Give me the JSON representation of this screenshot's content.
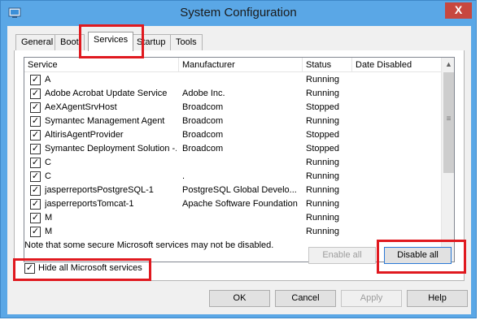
{
  "window": {
    "title": "System Configuration",
    "close_glyph": "X",
    "icon": "system-config-icon"
  },
  "tabs": [
    {
      "label": "General",
      "active": false
    },
    {
      "label": "Boot",
      "active": false
    },
    {
      "label": "Services",
      "active": true
    },
    {
      "label": "Startup",
      "active": false
    },
    {
      "label": "Tools",
      "active": false
    }
  ],
  "list": {
    "columns": [
      "Service",
      "Manufacturer",
      "Status",
      "Date Disabled"
    ],
    "rows": [
      {
        "checked": true,
        "service": "A",
        "manufacturer": "",
        "status": "Running",
        "date": ""
      },
      {
        "checked": true,
        "service": "Adobe Acrobat Update Service",
        "manufacturer": "Adobe Inc.",
        "status": "Running",
        "date": ""
      },
      {
        "checked": true,
        "service": "AeXAgentSrvHost",
        "manufacturer": "Broadcom",
        "status": "Stopped",
        "date": ""
      },
      {
        "checked": true,
        "service": "Symantec Management Agent",
        "manufacturer": "Broadcom",
        "status": "Running",
        "date": ""
      },
      {
        "checked": true,
        "service": "AltirisAgentProvider",
        "manufacturer": "Broadcom",
        "status": "Stopped",
        "date": ""
      },
      {
        "checked": true,
        "service": "Symantec Deployment Solution -...",
        "manufacturer": "Broadcom",
        "status": "Stopped",
        "date": ""
      },
      {
        "checked": true,
        "service": "C",
        "manufacturer": "",
        "status": "Running",
        "date": ""
      },
      {
        "checked": true,
        "service": "C",
        "manufacturer": ".",
        "status": "Running",
        "date": ""
      },
      {
        "checked": true,
        "service": "jasperreportsPostgreSQL-1",
        "manufacturer": "PostgreSQL Global Develo...",
        "status": "Running",
        "date": ""
      },
      {
        "checked": true,
        "service": "jasperreportsTomcat-1",
        "manufacturer": "Apache Software Foundation",
        "status": "Running",
        "date": ""
      },
      {
        "checked": true,
        "service": "M",
        "manufacturer": "",
        "status": "Running",
        "date": ""
      },
      {
        "checked": true,
        "service": "M",
        "manufacturer": "",
        "status": "Running",
        "date": ""
      }
    ]
  },
  "scrollbar": {
    "up": "▲",
    "down": "▼",
    "grip": "≡"
  },
  "note": "Note that some secure Microsoft services may not be disabled.",
  "buttons": {
    "enable_all": "Enable all",
    "disable_all": "Disable all",
    "ok": "OK",
    "cancel": "Cancel",
    "apply": "Apply",
    "help": "Help"
  },
  "hide_ms": {
    "label": "Hide all Microsoft services",
    "checked": true
  },
  "colors": {
    "title_bar": "#5aa7e6",
    "highlight": "#e0191f",
    "close": "#c7473f"
  }
}
